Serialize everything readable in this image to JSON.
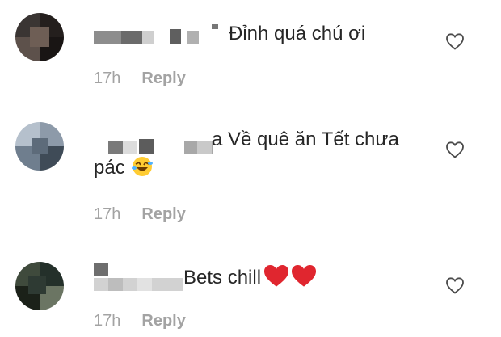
{
  "comments": [
    {
      "text": "Đỉnh quá chú ơi",
      "time": "17h",
      "reply": "Reply",
      "avatar_colors": [
        "#3a3533",
        "#241f1d",
        "#5d514b",
        "#191514"
      ]
    },
    {
      "text": "a Về quê ăn Tết chưa",
      "text_line2": "pác",
      "emoji": "rolling-on-floor-laughing",
      "time": "17h",
      "reply": "Reply",
      "avatar_colors": [
        "#8d9aa9",
        "#5d6b7a",
        "#c7d0da",
        "#3f4b57"
      ]
    },
    {
      "text": "Bets chill",
      "emoji": "red-heart x2",
      "time": "17h",
      "reply": "Reply",
      "avatar_colors": [
        "#3f4a3c",
        "#24302a",
        "#6b7563",
        "#1b2119"
      ]
    }
  ],
  "colors": {
    "text": "#262626",
    "meta": "#a3a3a3",
    "heart": "#e0262f",
    "emoji_face": "#ffcc33"
  }
}
